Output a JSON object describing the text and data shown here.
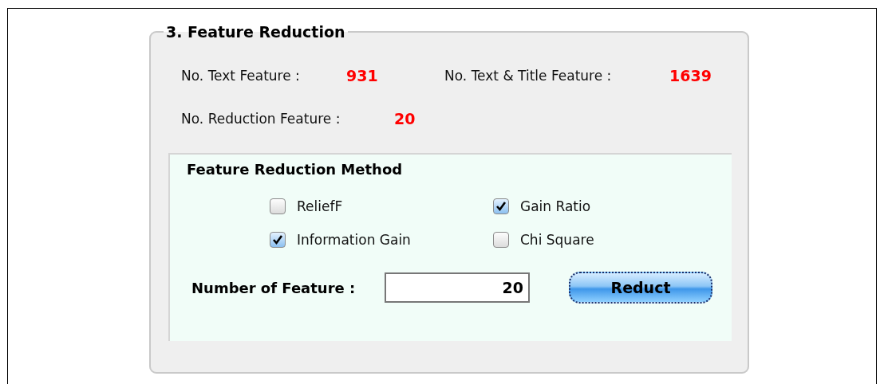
{
  "group": {
    "title": "3. Feature Reduction"
  },
  "stats": [
    {
      "label": "No. Text Feature :",
      "value": "931"
    },
    {
      "label": "No. Text & Title Feature :",
      "value": "1639"
    },
    {
      "label": "No. Reduction Feature :",
      "value": "20"
    }
  ],
  "method_panel": {
    "title": "Feature Reduction Method",
    "options": [
      {
        "label": "ReliefF",
        "checked": false
      },
      {
        "label": "Gain Ratio",
        "checked": true
      },
      {
        "label": "Information Gain",
        "checked": true
      },
      {
        "label": "Chi Square",
        "checked": false
      }
    ],
    "number_label": "Number of Feature :",
    "number_value": "20",
    "button": "Reduct"
  }
}
